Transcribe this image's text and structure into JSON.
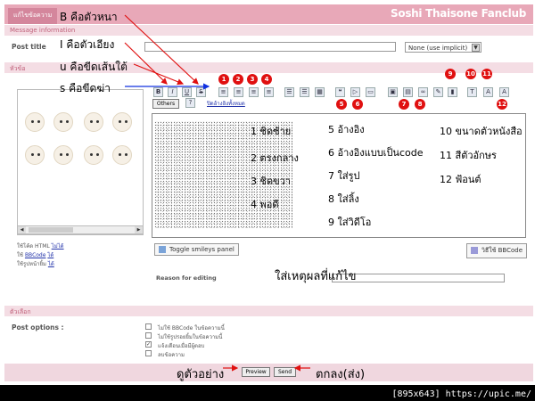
{
  "window": {
    "tab_label": "แก้ไขข้อความ",
    "brand": "Soshi Thaisone Fanclub",
    "caption": "[895x643] https://upic.me/"
  },
  "sections": {
    "message_info": "Message information",
    "subject": "หัวข้อ",
    "options": "ตัวเลือก"
  },
  "post_title": {
    "label": "Post title",
    "value": "",
    "icon_select": "None (use implicit)"
  },
  "toolbar": {
    "others_label": "Others",
    "quote_link": "ปิดอ้างอิงทั้งหมด",
    "buttons": [
      "B",
      "I",
      "U",
      "S"
    ]
  },
  "badges": [
    "1",
    "2",
    "3",
    "4",
    "5",
    "6",
    "7",
    "8",
    "9",
    "10",
    "11",
    "12"
  ],
  "left_notes": {
    "html": "ใช้โค้ด HTML",
    "html_state": "ไม่ได้",
    "bbcode": "ใช้",
    "bbcode_link": "BBCode",
    "bbcode_state": "ได้",
    "smilies": "ใช้รูปหน้ายิ้ม",
    "smilies_state": "ได้"
  },
  "annotations": {
    "bold": "B  คือตัวหนา",
    "italic": "I  คือตัวเอียง",
    "underline": "u  คือขีดเส้นใต้",
    "strike": "s  คือขีดฆ่า",
    "preview_hint": "ดูตัวอย่าง",
    "send_hint": "ตกลง(ส่ง)",
    "reason_hint": "ใส่เหตุผลที่แก้ไข"
  },
  "legend": [
    {
      "text": "1  ชิดซ้าย"
    },
    {
      "text": "2  ตรงกลาง"
    },
    {
      "text": "3  ชิดขวา"
    },
    {
      "text": "4  พอดี"
    },
    {
      "text": "5  อ้างอิง"
    },
    {
      "text": "6  อ้างอิงแบบเป็นcode"
    },
    {
      "text": "7  ใส่รูป"
    },
    {
      "text": "8  ใส่ลิ้ง"
    },
    {
      "text": "9  ใส่วิดีโอ"
    },
    {
      "text": "10  ขนาดตัวหนังสือ"
    },
    {
      "text": "11  สีตัวอักษร"
    },
    {
      "text": "12  ฟ้อนต์"
    }
  ],
  "editor": {
    "toggle_smileys": "Toggle smileys panel",
    "bbcode_view": "วิธีใช้ BBCode"
  },
  "reason": {
    "label": "Reason for editing",
    "value": ""
  },
  "post_options": {
    "label": "Post options :",
    "items": [
      {
        "label": "ไม่ใช้ BBCode ในข้อความนี้",
        "checked": false
      },
      {
        "label": "ไม่ใช้รูปรอยยิ้มในข้อความนี้",
        "checked": false
      },
      {
        "label": "แจ้งเตือนเมื่อมีผู้ตอบ",
        "checked": true
      },
      {
        "label": "ลบข้อความ",
        "checked": false
      }
    ]
  },
  "actions": {
    "preview": "Preview",
    "send": "Send"
  },
  "colors": {
    "accent": "#d4869c",
    "arrow": "#e01010",
    "badge": "#e01010"
  }
}
